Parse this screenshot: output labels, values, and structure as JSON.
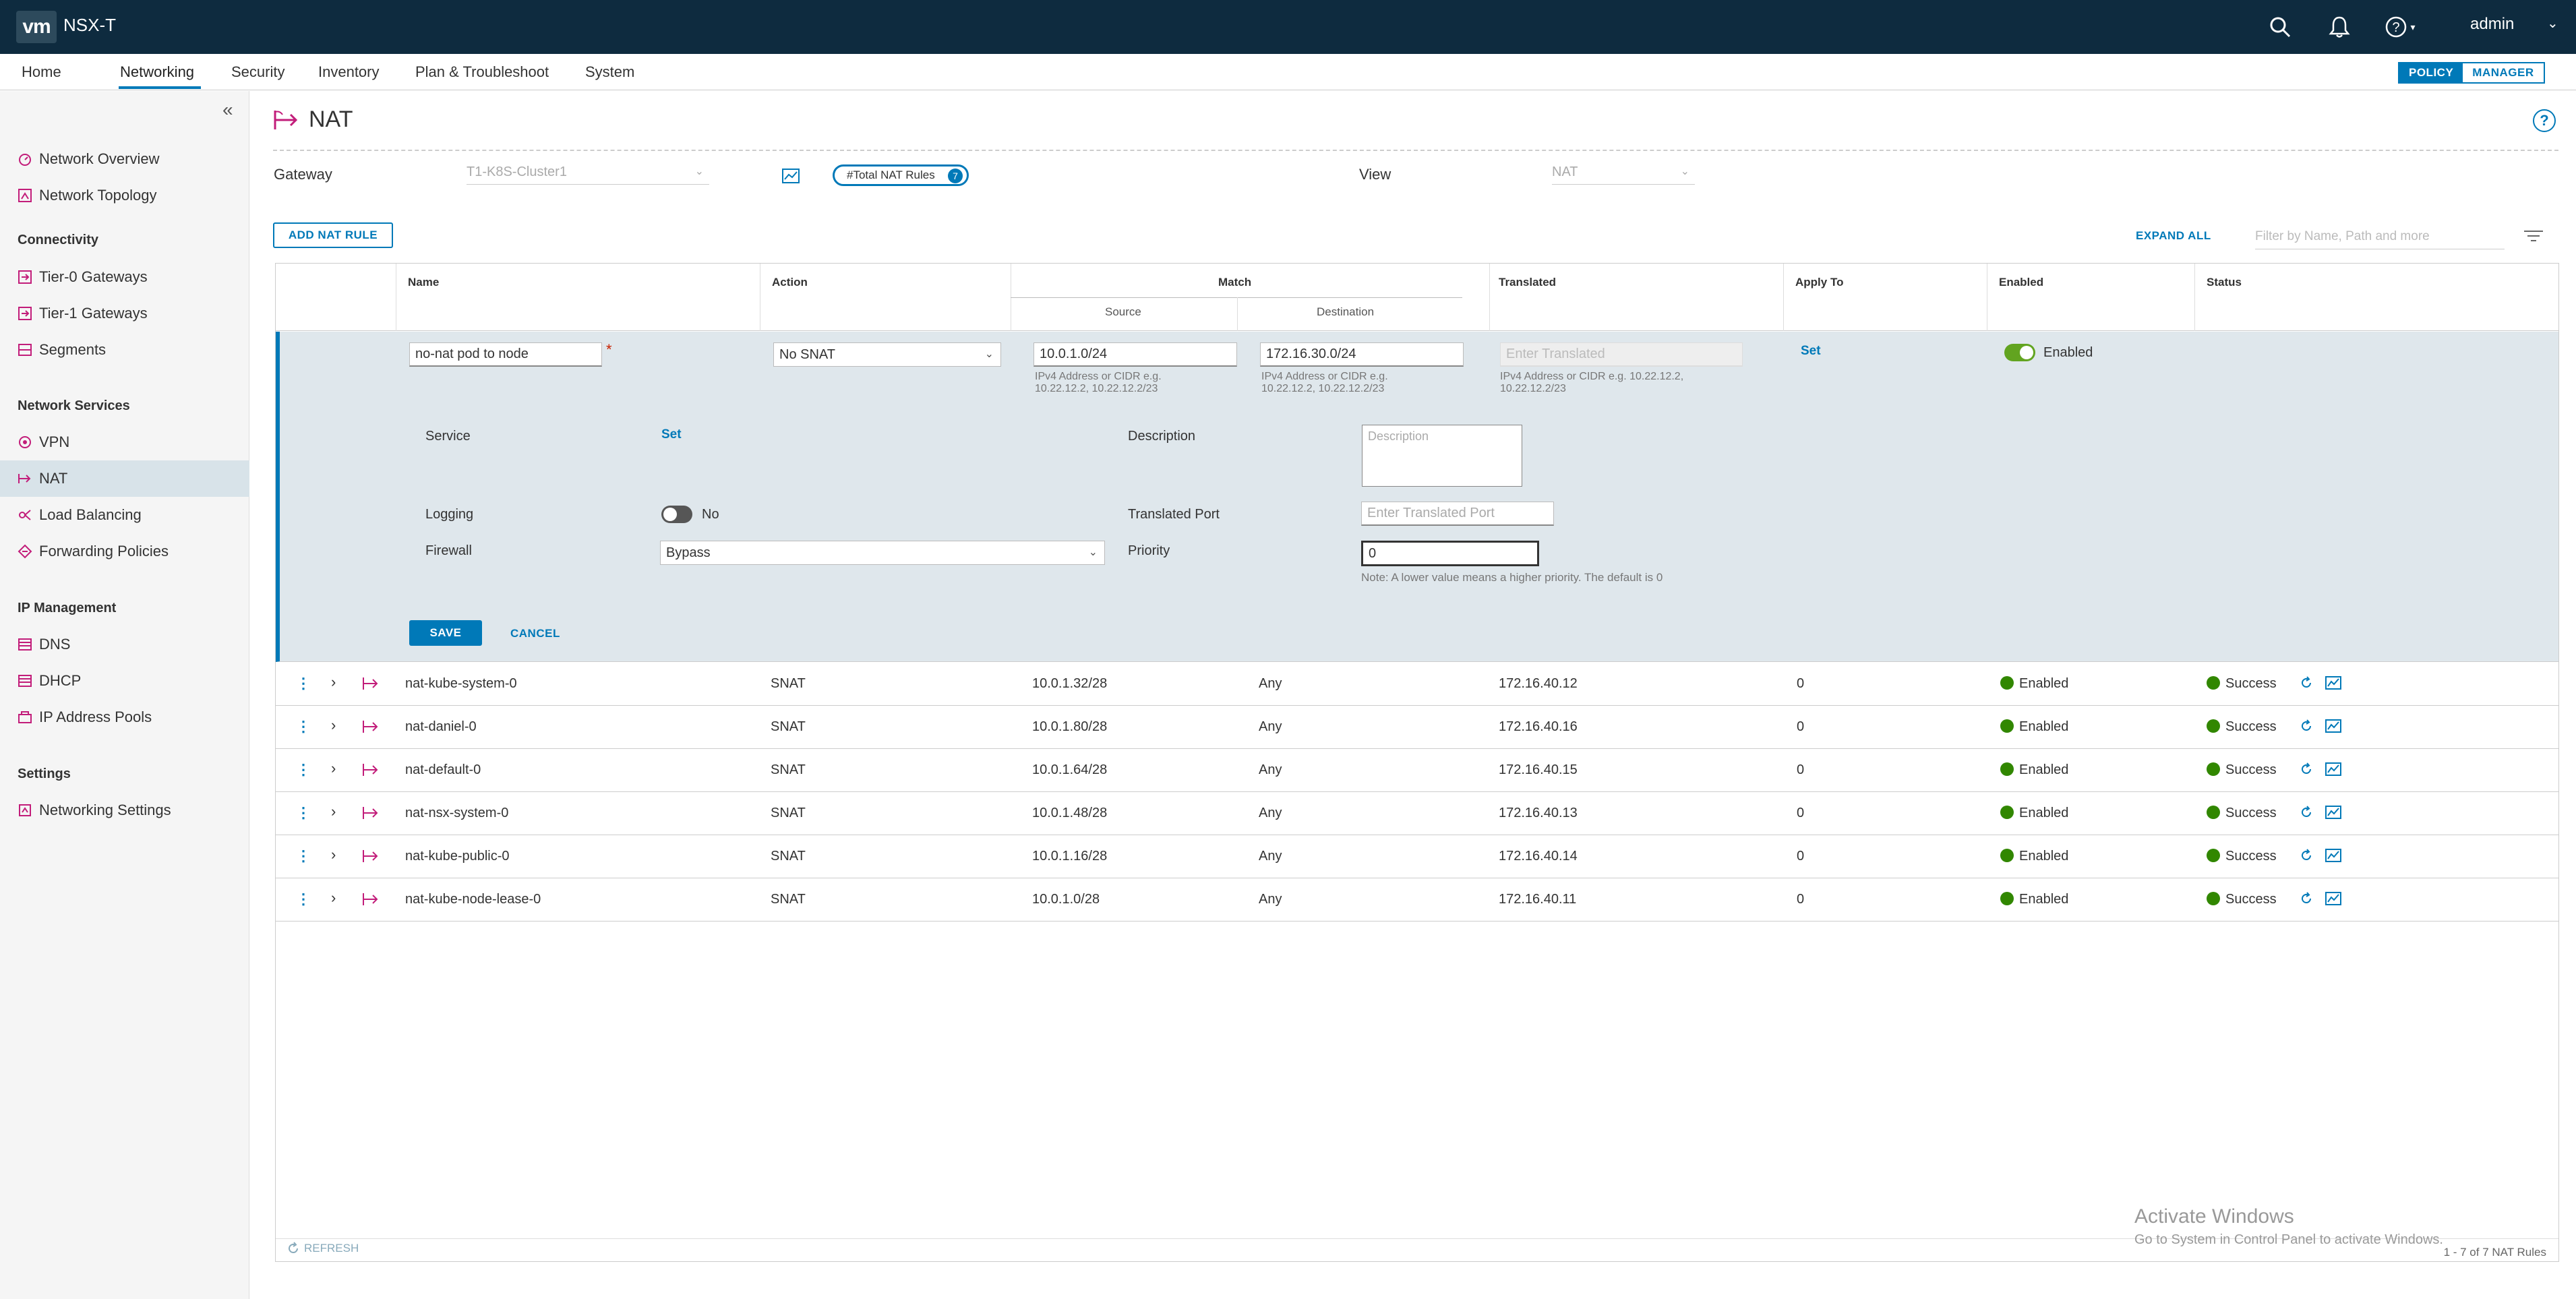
{
  "header": {
    "logo_text": "vm",
    "product": "NSX-T",
    "user": "admin",
    "icons": [
      "search-icon",
      "bell-icon",
      "help-icon"
    ]
  },
  "top_tabs": {
    "items": [
      {
        "label": "Home"
      },
      {
        "label": "Networking"
      },
      {
        "label": "Security"
      },
      {
        "label": "Inventory"
      },
      {
        "label": "Plan & Troubleshoot"
      },
      {
        "label": "System"
      }
    ],
    "active": "Networking",
    "mode_policy": "POLICY",
    "mode_manager": "MANAGER"
  },
  "sidebar": {
    "items": [
      {
        "label": "Network Overview",
        "icon": "network-overview-icon"
      },
      {
        "label": "Network Topology",
        "icon": "network-topology-icon"
      },
      {
        "label": "Tier-0 Gateways",
        "icon": "tier0-gateway-icon"
      },
      {
        "label": "Tier-1 Gateways",
        "icon": "tier1-gateway-icon"
      },
      {
        "label": "Segments",
        "icon": "segments-icon"
      },
      {
        "label": "VPN",
        "icon": "vpn-icon"
      },
      {
        "label": "NAT",
        "icon": "nat-icon"
      },
      {
        "label": "Load Balancing",
        "icon": "load-balancing-icon"
      },
      {
        "label": "Forwarding Policies",
        "icon": "forwarding-policies-icon"
      },
      {
        "label": "DNS",
        "icon": "dns-icon"
      },
      {
        "label": "DHCP",
        "icon": "dhcp-icon"
      },
      {
        "label": "IP Address Pools",
        "icon": "ip-pools-icon"
      },
      {
        "label": "Networking Settings",
        "icon": "settings-icon"
      }
    ],
    "sections": {
      "connectivity": "Connectivity",
      "network_services": "Network Services",
      "ip_management": "IP Management",
      "settings": "Settings"
    },
    "selected": "NAT"
  },
  "page": {
    "title": "NAT",
    "gateway_label": "Gateway",
    "gateway_value": "T1-K8S-Cluster1",
    "total_rules_label": "#Total NAT Rules",
    "total_rules_count": "7",
    "view_label": "View",
    "view_value": "NAT",
    "add_button": "ADD NAT RULE",
    "expand_all": "EXPAND ALL",
    "filter_placeholder": "Filter by Name, Path and more",
    "refresh": "REFRESH",
    "pagination": "1 - 7 of 7 NAT Rules"
  },
  "grid": {
    "headers": {
      "name": "Name",
      "action": "Action",
      "match": "Match",
      "source": "Source",
      "destination": "Destination",
      "translated": "Translated",
      "apply_to": "Apply To",
      "enabled": "Enabled",
      "status": "Status"
    },
    "edit_row": {
      "name": "no-nat pod to node",
      "action": "No SNAT",
      "source": "10.0.1.0/24",
      "destination": "172.16.30.0/24",
      "translated_placeholder": "Enter Translated",
      "hint_line1": "IPv4 Address or CIDR e.g.",
      "hint_line2": "10.22.12.2, 10.22.12.2/23",
      "hint_translated_line1": "IPv4 Address or CIDR e.g. 10.22.12.2,",
      "hint_translated_line2": "10.22.12.2/23",
      "apply_to": "Set",
      "enabled_label": "Enabled",
      "enabled": true,
      "service_label": "Service",
      "service_value": "Set",
      "description_label": "Description",
      "description_placeholder": "Description",
      "logging_label": "Logging",
      "logging_value": "No",
      "logging_on": false,
      "translated_port_label": "Translated Port",
      "translated_port_placeholder": "Enter Translated Port",
      "firewall_label": "Firewall",
      "firewall_value": "Bypass",
      "priority_label": "Priority",
      "priority_value": "0",
      "priority_note": "Note: A lower value means a higher priority. The default is 0",
      "save": "SAVE",
      "cancel": "CANCEL"
    },
    "rows": [
      {
        "name": "nat-kube-system-0",
        "action": "SNAT",
        "source": "10.0.1.32/28",
        "destination": "Any",
        "translated": "172.16.40.12",
        "apply_to": "0",
        "enabled": "Enabled",
        "status": "Success"
      },
      {
        "name": "nat-daniel-0",
        "action": "SNAT",
        "source": "10.0.1.80/28",
        "destination": "Any",
        "translated": "172.16.40.16",
        "apply_to": "0",
        "enabled": "Enabled",
        "status": "Success"
      },
      {
        "name": "nat-default-0",
        "action": "SNAT",
        "source": "10.0.1.64/28",
        "destination": "Any",
        "translated": "172.16.40.15",
        "apply_to": "0",
        "enabled": "Enabled",
        "status": "Success"
      },
      {
        "name": "nat-nsx-system-0",
        "action": "SNAT",
        "source": "10.0.1.48/28",
        "destination": "Any",
        "translated": "172.16.40.13",
        "apply_to": "0",
        "enabled": "Enabled",
        "status": "Success"
      },
      {
        "name": "nat-kube-public-0",
        "action": "SNAT",
        "source": "10.0.1.16/28",
        "destination": "Any",
        "translated": "172.16.40.14",
        "apply_to": "0",
        "enabled": "Enabled",
        "status": "Success"
      },
      {
        "name": "nat-kube-node-lease-0",
        "action": "SNAT",
        "source": "10.0.1.0/28",
        "destination": "Any",
        "translated": "172.16.40.11",
        "apply_to": "0",
        "enabled": "Enabled",
        "status": "Success"
      }
    ]
  },
  "watermark": {
    "line1": "Activate Windows",
    "line2": "Go to System in Control Panel to activate Windows."
  },
  "colors": {
    "header_bg": "#0e2b3f",
    "accent": "#0079b8",
    "nat_icon": "#c21d7a",
    "success": "#318700",
    "edit_bg": "#dfe7ec"
  }
}
